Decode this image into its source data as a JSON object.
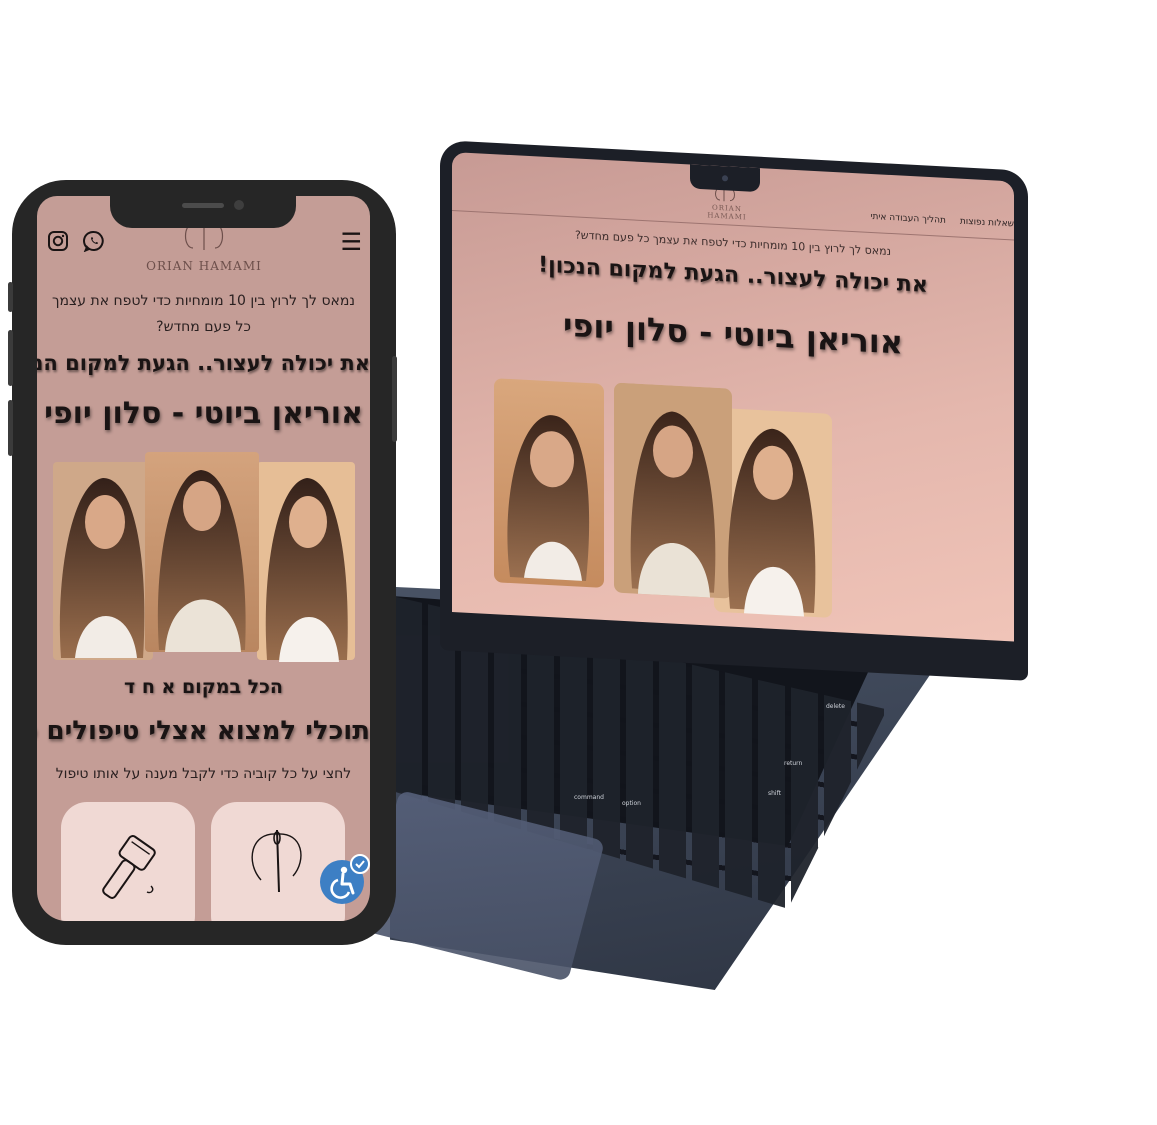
{
  "laptop_site": {
    "logo_text": "ORIAN HAMAMI",
    "nav_items": [
      "תהליך העבודה איתי",
      "שאלות נפוצות"
    ],
    "subtitle": "נמאס לך לרוץ בין 10 מומחיות כדי לטפח את עצמך כל פעם מחדש?",
    "headline": "את יכולה לעצור.. הגעת למקום הנכון!",
    "title": "אוריאן ביוטי - סלון יופי"
  },
  "keyboard": {
    "labels": {
      "delete": "delete",
      "return": "return",
      "shift": "shift",
      "command": "command",
      "option": "option"
    }
  },
  "phone_site": {
    "logo_text": "ORIAN HAMAMI",
    "menu_icon": "☰",
    "subtitle": "נמאס לך לרוץ בין 10 מומחיות כדי לטפח את עצמך כל פעם מחדש?",
    "headline": "את יכולה לעצור.. הגעת למקום הנכון!",
    "title": "אוריאן ביוטי - סלון יופי",
    "section_kicker": "הכל במקום א ח ד",
    "section_title": "תוכלי למצוא אצלי טיפולים כמו",
    "section_note": "לחצי על כל קוביה כדי לקבל מענה על אותו טיפול",
    "icons": [
      "instagram-icon",
      "whatsapp-icon",
      "menu-icon",
      "accessibility-icon"
    ]
  }
}
